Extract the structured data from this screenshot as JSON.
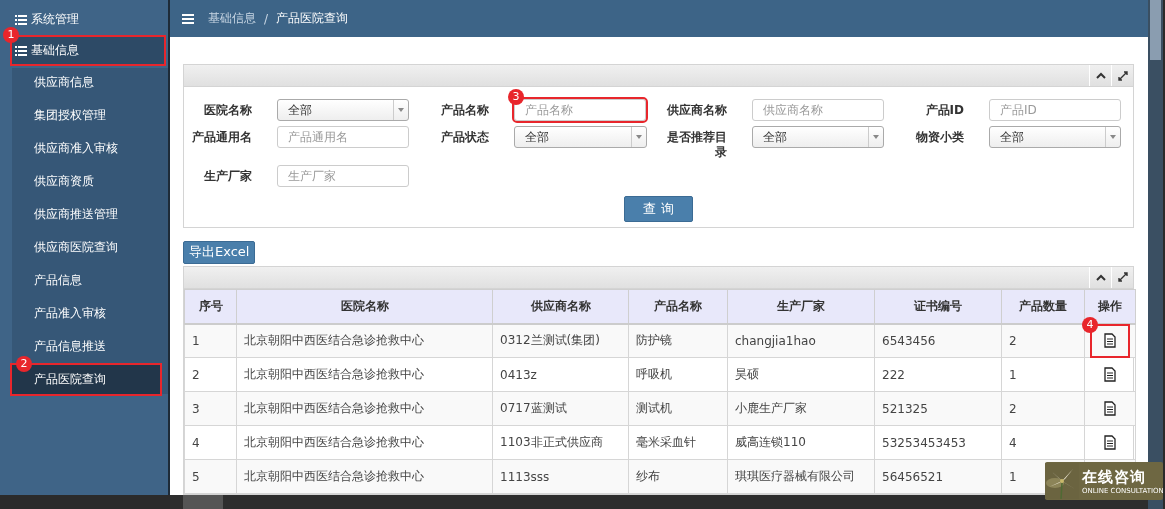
{
  "sidebar": {
    "groups": [
      {
        "label": "系统管理",
        "selected": false
      },
      {
        "label": "基础信息",
        "selected": true,
        "callout": "1",
        "children": [
          {
            "label": "供应商信息",
            "selected": false
          },
          {
            "label": "集团授权管理",
            "selected": false
          },
          {
            "label": "供应商准入审核",
            "selected": false
          },
          {
            "label": "供应商资质",
            "selected": false
          },
          {
            "label": "供应商推送管理",
            "selected": false
          },
          {
            "label": "供应商医院查询",
            "selected": false
          },
          {
            "label": "产品信息",
            "selected": false
          },
          {
            "label": "产品准入审核",
            "selected": false
          },
          {
            "label": "产品信息推送",
            "selected": false
          },
          {
            "label": "产品医院查询",
            "selected": true,
            "callout": "2"
          }
        ]
      }
    ]
  },
  "breadcrumb": {
    "items": [
      "基础信息",
      "产品医院查询"
    ],
    "separator": "/"
  },
  "filters": {
    "fields": [
      {
        "label": "医院名称",
        "kind": "select",
        "value": "全部"
      },
      {
        "label": "产品名称",
        "kind": "text",
        "placeholder": "产品名称",
        "callout": "3"
      },
      {
        "label": "供应商名称",
        "kind": "text",
        "placeholder": "供应商名称"
      },
      {
        "label": "产品ID",
        "kind": "text",
        "placeholder": "产品ID"
      },
      {
        "label": "产品通用名",
        "kind": "text",
        "placeholder": "产品通用名"
      },
      {
        "label": "产品状态",
        "kind": "select",
        "value": "全部"
      },
      {
        "label": "是否推荐目录",
        "kind": "select",
        "value": "全部"
      },
      {
        "label": "物资小类",
        "kind": "select",
        "value": "全部"
      },
      {
        "label": "生产厂家",
        "kind": "text",
        "placeholder": "生产厂家"
      }
    ],
    "query_button": "查 询"
  },
  "export_button": "导出Excel",
  "table": {
    "columns": [
      "序号",
      "医院名称",
      "供应商名称",
      "产品名称",
      "生产厂家",
      "证书编号",
      "产品数量",
      "操作"
    ],
    "rows": [
      {
        "cells": [
          "1",
          "北京朝阳中西医结合急诊抢救中心",
          "0312兰测试(集团)",
          "防护镜",
          "changjia1hao",
          "6543456",
          "2"
        ],
        "action": true,
        "callout": "4"
      },
      {
        "cells": [
          "2",
          "北京朝阳中西医结合急诊抢救中心",
          "0413z",
          "呼吸机",
          "昊硕",
          "222",
          "1"
        ],
        "action": true
      },
      {
        "cells": [
          "3",
          "北京朝阳中西医结合急诊抢救中心",
          "0717蓝测试",
          "测试机",
          "小鹿生产厂家",
          "521325",
          "2"
        ],
        "action": true
      },
      {
        "cells": [
          "4",
          "北京朝阳中西医结合急诊抢救中心",
          "1103非正式供应商",
          "毫米采血针",
          "威高连锁110",
          "53253453453",
          "4"
        ],
        "action": true
      },
      {
        "cells": [
          "5",
          "北京朝阳中西医结合急诊抢救中心",
          "1113sss",
          "纱布",
          "琪琪医疗器械有限公司",
          "56456521",
          "1"
        ],
        "action": false
      }
    ]
  },
  "chat_widget": {
    "title": "在线咨询",
    "subtitle": "ONLINE CONSULTATION"
  }
}
